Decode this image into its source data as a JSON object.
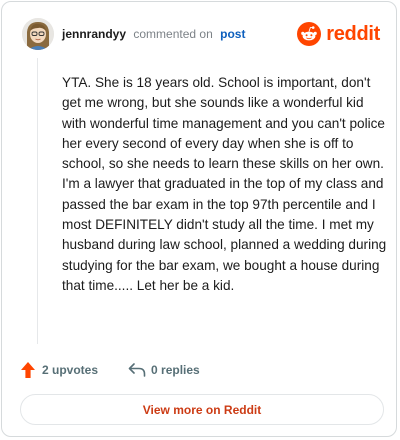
{
  "comment": {
    "username": "jennrandyy",
    "action_text": "commented on",
    "post_link": "post",
    "body": "YTA. She is 18 years old. School is important, don't get me wrong, but she sounds like a wonderful kid with wonderful time management and you can't police her every second of every day when she is off to school, so she needs to learn these skills on her own. I'm a lawyer that graduated in the top of my class and passed the bar exam in the top 97th percentile and I most DEFINITELY didn't study all the time. I met my husband during law school, planned a wedding during studying for the bar exam, we bought a house during that time..... Let her be a kid."
  },
  "brand": {
    "wordmark": "reddit",
    "color": "#ff4500"
  },
  "stats": {
    "upvotes": "2 upvotes",
    "replies": "0 replies"
  },
  "footer": {
    "view_more": "View more on Reddit"
  },
  "icons": {
    "avatar": "user-avatar",
    "brand": "reddit-logo-icon",
    "upvote": "upvote-arrow-icon",
    "reply": "reply-arrow-icon"
  }
}
